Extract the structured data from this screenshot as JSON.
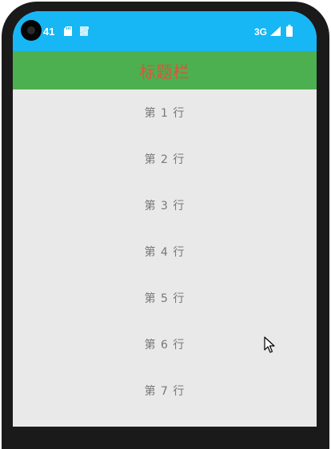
{
  "status_bar": {
    "time": "41",
    "network_type": "3G",
    "background_color": "#17b6f5",
    "icons": [
      "camera-icon",
      "sd-card-icon",
      "sync-icon",
      "signal-icon",
      "battery-icon"
    ]
  },
  "title_bar": {
    "title": "标题栏",
    "background_color": "#4caf50",
    "title_color": "#e2523a"
  },
  "list": {
    "items": [
      {
        "label": "第 1 行"
      },
      {
        "label": "第 2 行"
      },
      {
        "label": "第 3 行"
      },
      {
        "label": "第 4 行"
      },
      {
        "label": "第 5 行"
      },
      {
        "label": "第 6 行"
      },
      {
        "label": "第 7 行"
      }
    ]
  }
}
